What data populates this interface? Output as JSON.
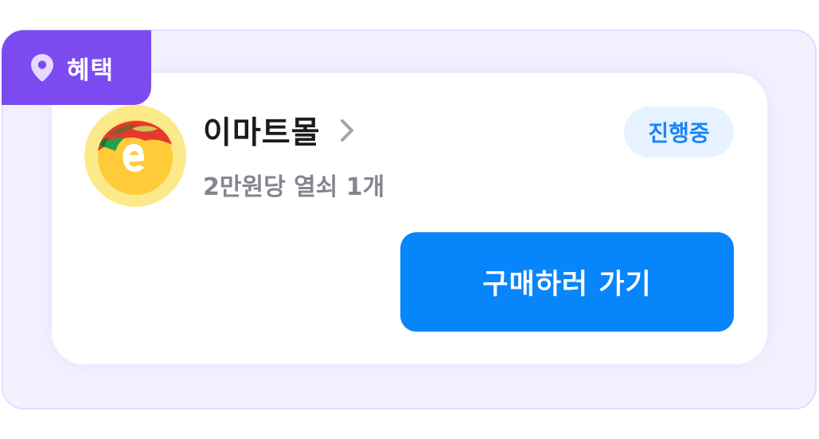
{
  "tag": {
    "label": "혜택",
    "icon": "location-pin-icon",
    "color": "#7b4bf0"
  },
  "store": {
    "name": "이마트몰",
    "logo": "emart-logo",
    "chevron_icon": "chevron-right-icon",
    "offer": "2만원당 열쇠 1개"
  },
  "status": {
    "label": "진행중",
    "color": "#1a86f5",
    "background": "#e6f2ff"
  },
  "action": {
    "label": "구매하러 가기",
    "color": "#0786fb"
  },
  "theme": {
    "frame_background": "#f3f1ff",
    "frame_border": "#e3defa",
    "card_background": "#ffffff"
  }
}
